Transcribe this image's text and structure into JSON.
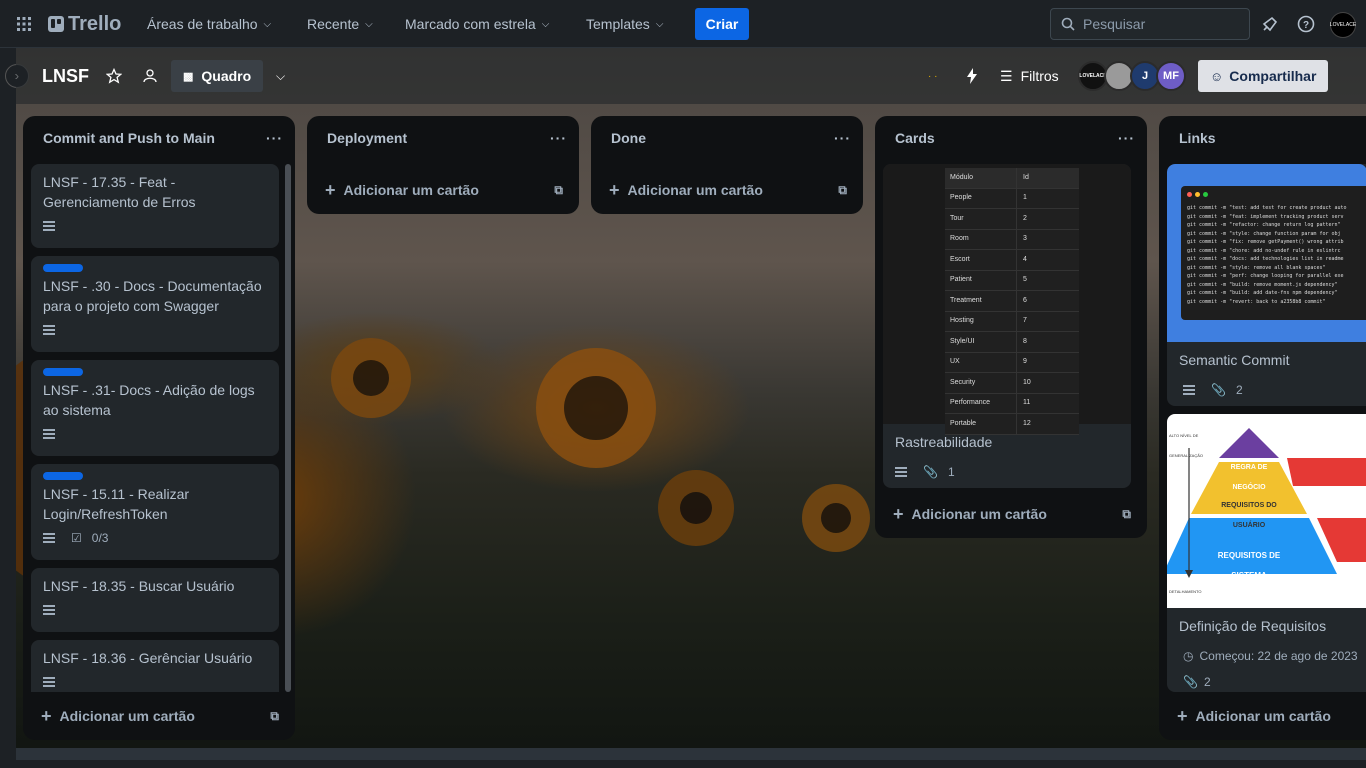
{
  "topbar": {
    "logo": "Trello",
    "nav": [
      {
        "label": "Áreas de trabalho"
      },
      {
        "label": "Recente"
      },
      {
        "label": "Marcado com estrela"
      },
      {
        "label": "Templates"
      }
    ],
    "create": "Criar",
    "search_placeholder": "Pesquisar",
    "avatar_text": "LOVELACE"
  },
  "board": {
    "title": "LNSF",
    "view": "Quadro",
    "filters": "Filtros",
    "share": "Compartilhar",
    "members": [
      {
        "initials": "",
        "color": "#111111"
      },
      {
        "initials": "",
        "color": "#888888"
      },
      {
        "initials": "J",
        "color": "#1f3b6e"
      },
      {
        "initials": "MF",
        "color": "#6e5dc6"
      }
    ]
  },
  "add_card_label": "Adicionar um cartão",
  "lists": {
    "l1": {
      "title": "Commit and Push to Main",
      "cards": [
        {
          "title": "LNSF - 17.35 - Feat - Gerenciamento de Erros"
        },
        {
          "title": "LNSF - .30 - Docs - Documentação para o projeto com Swagger"
        },
        {
          "title": "LNSF - .31- Docs - Adição de logs ao sistema"
        },
        {
          "title": "LNSF - 15.11 - Realizar Login/RefreshToken",
          "checklist": "0/3"
        },
        {
          "title": "LNSF - 18.35 - Buscar Usuário"
        },
        {
          "title": "LNSF - 18.36 - Gerênciar Usuário"
        }
      ]
    },
    "l2": {
      "title": "Deployment"
    },
    "l3": {
      "title": "Done"
    },
    "l4": {
      "title": "Cards",
      "card": {
        "title": "Rastreabilidade",
        "attachments": "1",
        "table_header": [
          "Módulo",
          "Id"
        ],
        "table_rows": [
          [
            "People",
            "1"
          ],
          [
            "Tour",
            "2"
          ],
          [
            "Room",
            "3"
          ],
          [
            "Escort",
            "4"
          ],
          [
            "Patient",
            "5"
          ],
          [
            "Treatment",
            "6"
          ],
          [
            "Hosting",
            "7"
          ],
          [
            "Style/UI",
            "8"
          ],
          [
            "UX",
            "9"
          ],
          [
            "Security",
            "10"
          ],
          [
            "Performance",
            "11"
          ],
          [
            "Portable",
            "12"
          ]
        ]
      }
    },
    "l5": {
      "title": "Links",
      "card1": {
        "title": "Semantic Commit",
        "attachments": "2",
        "code_lines": [
          "git commit -m \"test: add test for create product auto",
          "git commit -m \"feat: implement tracking product serv",
          "git commit -m \"refactor: change return log pattern\"",
          "git commit -m \"style: change function param for obj",
          "git commit -m \"fix: remove getPayment() wrong attrib",
          "git commit -m \"chore: add no-undef rule in eslintrc",
          "git commit -m \"docs: add technologies list in readme",
          "git commit -m \"style: remove all blank spaces\"",
          "git commit -m \"perf: change looping for parallel exe",
          "git commit -m \"build: remove moment.js dependency\"",
          "git commit -m \"build: add date-fns npm dependency\"",
          "git commit -m \"revert: back to a2358b8 commit\""
        ]
      },
      "card2": {
        "title": "Definição de Requisitos",
        "started": "Começou: 22 de ago de 2023",
        "attachments": "2",
        "pyramid": {
          "top": "REGRA DE NEGÓCIO",
          "middle": "REQUISITOS DO USUÁRIO",
          "bottom": "REQUISITOS DE SISTEMA",
          "axis_top": "ALTO NÍVEL DE GENERALIZAÇÃO",
          "axis_bottom": "DETALHAMENTO ESPECÍFICO"
        }
      }
    }
  }
}
